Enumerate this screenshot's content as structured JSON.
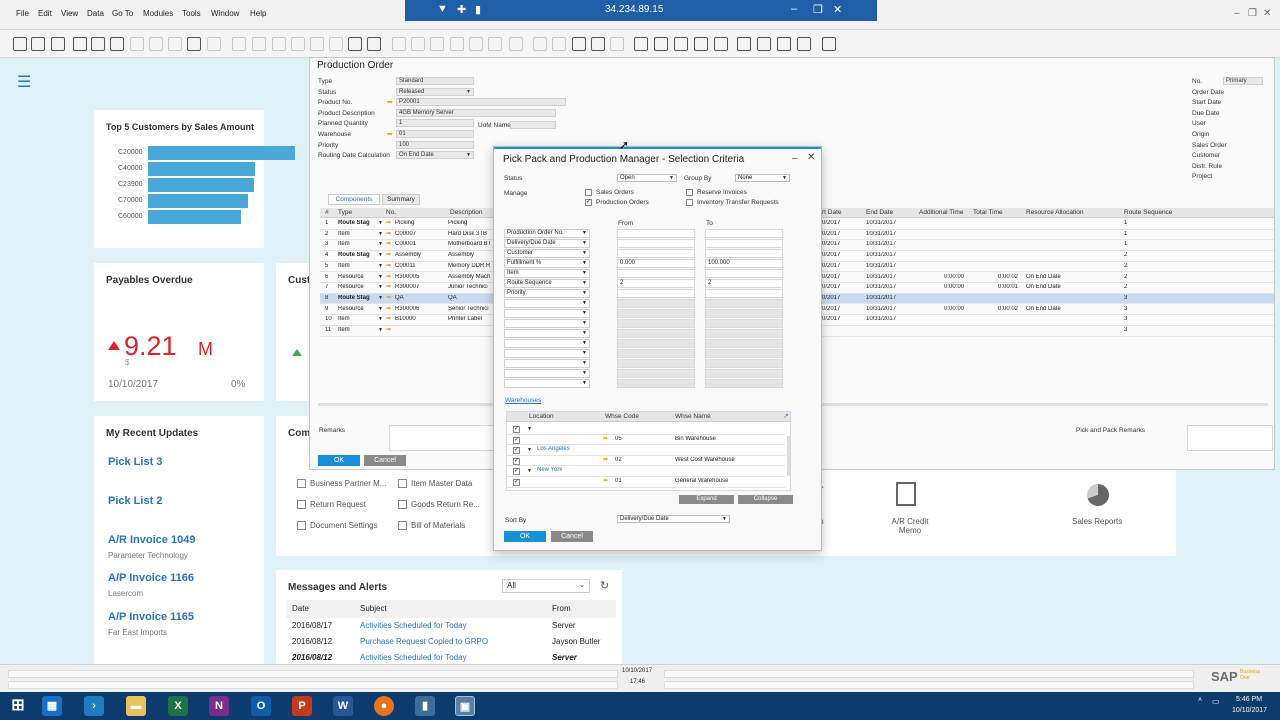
{
  "menu": [
    "File",
    "Edit",
    "View",
    "Data",
    "Go To",
    "Modules",
    "Tools",
    "Window",
    "Help"
  ],
  "rdp": {
    "ip": "34.234.89.15"
  },
  "cockpit": {
    "top5": {
      "title": "Top 5 Customers by Sales Amount",
      "customers": [
        "C20000",
        "C40000",
        "C23900",
        "C70000",
        "C60000"
      ],
      "values": [
        100,
        73,
        72,
        68,
        63
      ]
    },
    "payables": {
      "title": "Payables Overdue",
      "amount": "9.21",
      "unit": "M",
      "currency": "$",
      "date": "10/10/2017",
      "percent": "0%"
    },
    "cust_partial": "Cust",
    "comm_partial": "Com",
    "recent": {
      "title": "My Recent Updates",
      "items": [
        {
          "title": "Pick List 3",
          "sub": ""
        },
        {
          "title": "Pick List 2",
          "sub": ""
        },
        {
          "title": "A/R Invoice 1049",
          "sub": "Parameter Technology"
        },
        {
          "title": "A/P Invoice 1166",
          "sub": "Lasercom"
        },
        {
          "title": "A/P Invoice 1165",
          "sub": "Far East Imports"
        }
      ]
    },
    "shortcuts": [
      "Business Partner M...",
      "Item Master Data",
      "Return Request",
      "Goods Return Re...",
      "Document Settings",
      "Bill of Materials"
    ],
    "tiles": [
      {
        "label": "m",
        "label2": ""
      },
      {
        "label": "A/R Credit",
        "label2": "Memo"
      },
      {
        "label": "Sales Reports",
        "label2": ""
      }
    ]
  },
  "production_order": {
    "title": "Production Order",
    "fields": [
      {
        "label": "Type",
        "value": "Standard"
      },
      {
        "label": "Status",
        "value": "Released"
      },
      {
        "label": "Product No.",
        "value": "P20001"
      },
      {
        "label": "Product Description",
        "value": "4GB Memory Server"
      },
      {
        "label": "Planned Quantity",
        "value": "1"
      },
      {
        "label": "Warehouse",
        "value": "01"
      },
      {
        "label": "Priority",
        "value": "100"
      },
      {
        "label": "Routing Date Calculation",
        "value": "On End Date"
      }
    ],
    "uom_label": "UoM Name",
    "right_labels": [
      "No.",
      "Order Date",
      "Start Date",
      "Due Date",
      "User",
      "Origin",
      "Sales Order",
      "Customer",
      "Distr. Rule",
      "Project"
    ],
    "no_value": "Primary",
    "tabs": [
      "Components",
      "Summary"
    ],
    "columns": [
      "#",
      "Type",
      "No.",
      "Description"
    ],
    "rows": [
      {
        "n": "1",
        "type": "Route Stag",
        "no": "Picking",
        "desc": "Picking"
      },
      {
        "n": "2",
        "type": "Item",
        "no": "C00007",
        "desc": "Hard Disk 3TB"
      },
      {
        "n": "3",
        "type": "Item",
        "no": "C00001",
        "desc": "Motherboard BT"
      },
      {
        "n": "4",
        "type": "Route Stag",
        "no": "Assembly",
        "desc": "Assembly"
      },
      {
        "n": "5",
        "type": "Item",
        "no": "C00011",
        "desc": "Memory DDR R"
      },
      {
        "n": "6",
        "type": "Resource",
        "no": "R300005",
        "desc": "Assembly Mach"
      },
      {
        "n": "7",
        "type": "Resource",
        "no": "R300007",
        "desc": "Junior Technici"
      },
      {
        "n": "8",
        "type": "Route Stag",
        "no": "QA",
        "desc": "QA"
      },
      {
        "n": "9",
        "type": "Resource",
        "no": "R300006",
        "desc": "Senior Technici"
      },
      {
        "n": "10",
        "type": "Item",
        "no": "B10000",
        "desc": "Printer Label"
      },
      {
        "n": "11",
        "type": "Item",
        "no": "",
        "desc": ""
      }
    ],
    "right_columns": [
      "rt Date",
      "End Date",
      "Additional Time",
      "Total Time",
      "Resource Allocation",
      "Route Sequence"
    ],
    "right_rows": [
      {
        "s": "0/2017",
        "e": "10/31/2017",
        "a": "",
        "t": "",
        "r": "",
        "q": "1"
      },
      {
        "s": "0/2017",
        "e": "10/31/2017",
        "a": "",
        "t": "",
        "r": "",
        "q": "1"
      },
      {
        "s": "0/2017",
        "e": "10/31/2017",
        "a": "",
        "t": "",
        "r": "",
        "q": "1"
      },
      {
        "s": "0/2017",
        "e": "10/31/2017",
        "a": "",
        "t": "",
        "r": "",
        "q": "2"
      },
      {
        "s": "0/2017",
        "e": "10/31/2017",
        "a": "",
        "t": "",
        "r": "",
        "q": "2"
      },
      {
        "s": "0/2017",
        "e": "10/31/2017",
        "a": "0:00:00",
        "t": "0:00:02",
        "r": "On End Date",
        "q": "2"
      },
      {
        "s": "0/2017",
        "e": "10/31/2017",
        "a": "0:00:00",
        "t": "0:00:01",
        "r": "On End Date",
        "q": "2"
      },
      {
        "s": "0/2017",
        "e": "10/31/2017",
        "a": "",
        "t": "",
        "r": "",
        "q": "3"
      },
      {
        "s": "0/2017",
        "e": "10/31/2017",
        "a": "0:00:00",
        "t": "0:00:02",
        "r": "On End Date",
        "q": "3"
      },
      {
        "s": "0/2017",
        "e": "10/31/2017",
        "a": "",
        "t": "",
        "r": "",
        "q": "3"
      },
      {
        "s": "",
        "e": "",
        "a": "",
        "t": "",
        "r": "",
        "q": "3"
      }
    ],
    "remarks_label": "Remarks",
    "pick_remarks_label": "Pick and Pack Remarks",
    "ok": "OK",
    "cancel": "Cancel"
  },
  "dialog": {
    "title": "Pick Pack and Production Manager - Selection Criteria",
    "status_label": "Status",
    "status_value": "Open",
    "group_label": "Group By",
    "group_value": "None",
    "manage_label": "Manage",
    "checks": [
      {
        "label": "Sales Orders",
        "checked": ""
      },
      {
        "label": "Production Orders",
        "checked": "✓"
      },
      {
        "label": "Reserve Invoices",
        "checked": ""
      },
      {
        "label": "Inventory Transfer Requests",
        "checked": ""
      }
    ],
    "from_label": "From",
    "to_label": "To",
    "criteria": [
      {
        "name": "Production Order No.",
        "from": "",
        "to": ""
      },
      {
        "name": "Delivery/Due Date",
        "from": "",
        "to": ""
      },
      {
        "name": "Customer",
        "from": "",
        "to": ""
      },
      {
        "name": "Fulfillment %",
        "from": "0.000",
        "to": "100.000"
      },
      {
        "name": "Item",
        "from": "",
        "to": ""
      },
      {
        "name": "Route Sequence",
        "from": "2",
        "to": "2"
      },
      {
        "name": "Priority",
        "from": "",
        "to": ""
      },
      {
        "name": "",
        "from": "",
        "to": ""
      },
      {
        "name": "",
        "from": "",
        "to": ""
      },
      {
        "name": "",
        "from": "",
        "to": ""
      },
      {
        "name": "",
        "from": "",
        "to": ""
      },
      {
        "name": "",
        "from": "",
        "to": ""
      },
      {
        "name": "",
        "from": "",
        "to": ""
      },
      {
        "name": "",
        "from": "",
        "to": ""
      },
      {
        "name": "",
        "from": "",
        "to": ""
      },
      {
        "name": "",
        "from": "",
        "to": ""
      }
    ],
    "warehouses_label": "Warehouses",
    "wh_columns": [
      "Location",
      "Whse Code",
      "Whse Name"
    ],
    "wh_rows": [
      {
        "loc": "",
        "code": "",
        "name": "",
        "group": "yes"
      },
      {
        "loc": "",
        "code": "05",
        "name": "Bin Warehouse",
        "group": ""
      },
      {
        "loc": "Los Angeles",
        "code": "",
        "name": "",
        "group": "yes"
      },
      {
        "loc": "",
        "code": "02",
        "name": "West Cost Warehouse",
        "group": ""
      },
      {
        "loc": "New York",
        "code": "",
        "name": "",
        "group": "yes"
      },
      {
        "loc": "",
        "code": "01",
        "name": "General Warehouse",
        "group": ""
      }
    ],
    "expand": "Expand",
    "collapse": "Collapse",
    "sort_label": "Sort By",
    "sort_value": "Delivery/Due Date",
    "ok": "OK",
    "cancel": "Cancel"
  },
  "messages": {
    "title": "Messages and Alerts",
    "filter": "All",
    "columns": [
      "Date",
      "Subject",
      "From"
    ],
    "rows": [
      {
        "date": "2016/08/17",
        "subject": "Activities Scheduled for Today",
        "from": "Server"
      },
      {
        "date": "2016/08/12",
        "subject": "Purchase Request Copied to GRPO",
        "from": "Jayson Butler"
      },
      {
        "date": "2016/08/12",
        "subject": "Activities Scheduled for Today",
        "from": "Server"
      }
    ]
  },
  "statusbar": {
    "date": "10/10/2017",
    "time": "17:46",
    "brand": "SAP",
    "brand2": "Business One"
  },
  "taskbar": {
    "time": "5:46 PM",
    "date": "10/10/2017"
  },
  "colors": {
    "accent": "#1990d5",
    "bar": "#4aa8d8",
    "alert": "#d9232d",
    "rdp": "#1f5fa8"
  }
}
